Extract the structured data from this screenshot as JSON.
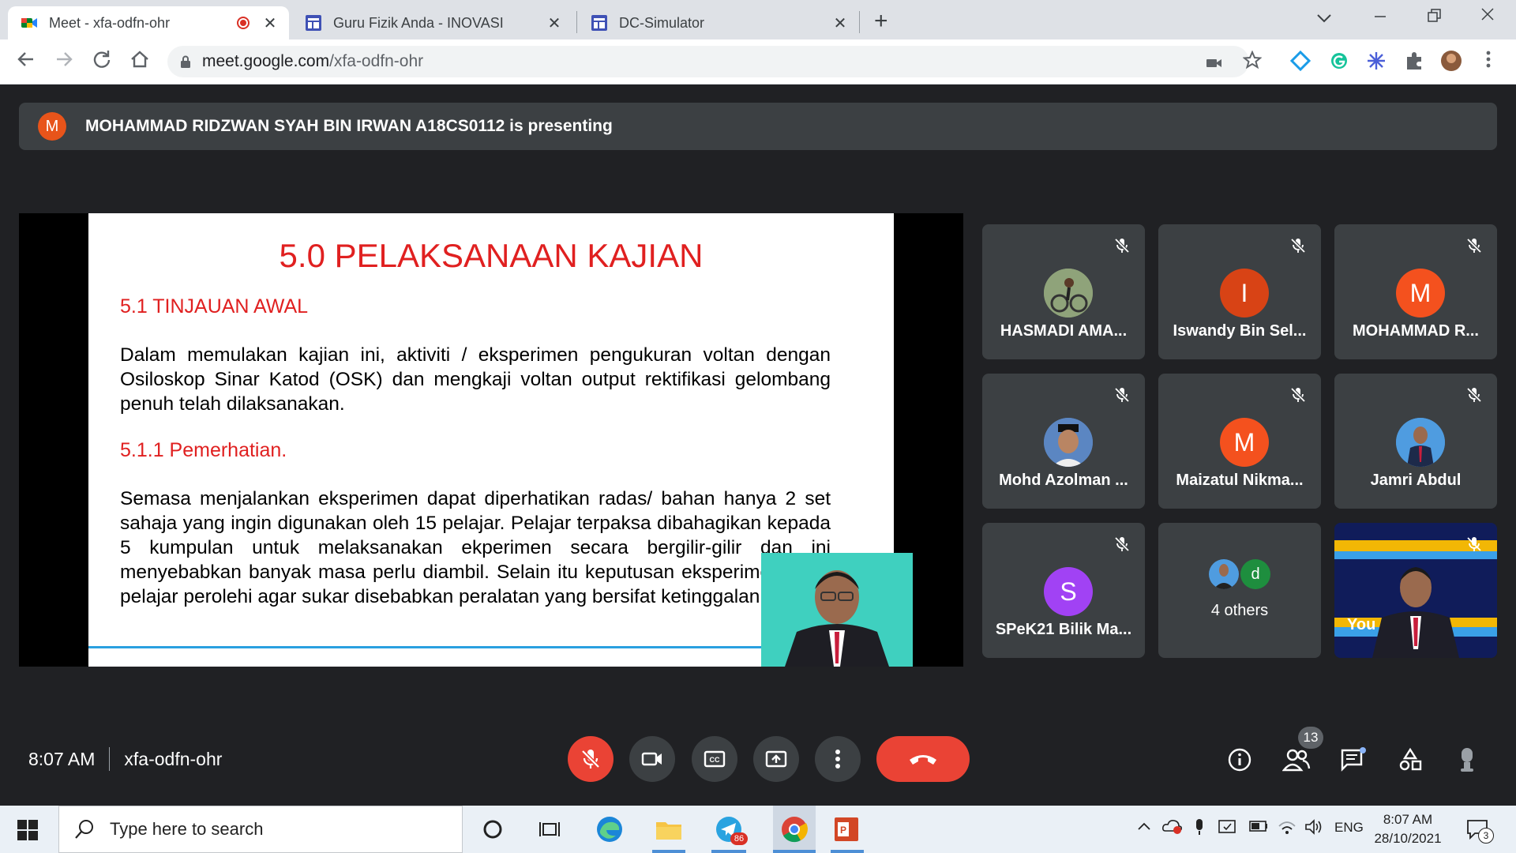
{
  "browser": {
    "tabs": [
      {
        "title": "Meet - xfa-odfn-ohr",
        "icon": "google-meet-icon",
        "recording": true
      },
      {
        "title": "Guru Fizik Anda - INOVASI",
        "icon": "google-sites-icon"
      },
      {
        "title": "DC-Simulator",
        "icon": "google-sites-icon"
      }
    ],
    "url_domain": "meet.google.com",
    "url_path": "/xfa-odfn-ohr"
  },
  "meet": {
    "presenter_initial": "M",
    "presenter_text": "MOHAMMAD RIDZWAN SYAH BIN IRWAN A18CS0112 is presenting",
    "slide": {
      "title": "5.0 PELAKSANAAN KAJIAN",
      "section1": "5.1 TINJAUAN AWAL",
      "para1": "Dalam memulakan kajian ini, aktiviti / eksperimen pengukuran voltan dengan Osiloskop Sinar Katod (OSK) dan mengkaji voltan output rektifikasi gelombang penuh telah dilaksanakan.",
      "section2": "5.1.1 Pemerhatian.",
      "para2": "Semasa menjalankan eksperimen dapat diperhatikan radas/ bahan hanya 2 set sahaja yang ingin digunakan oleh 15 pelajar. Pelajar terpaksa dibahagikan kepada 5 kumpulan untuk melaksanakan ekperimen secara bergilir-gilir dan ini menyebabkan banyak masa perlu diambil. Selain itu keputusan eksperimen yang pelajar perolehi agar sukar disebabkan peralatan yang bersifat ketinggalan zaman."
    },
    "participants": [
      {
        "name": "HASMADI AMA...",
        "initial": "",
        "color": "#7d8a6a",
        "muted": true
      },
      {
        "name": "Iswandy Bin Sel...",
        "initial": "I",
        "color": "#d84315",
        "muted": true
      },
      {
        "name": "MOHAMMAD R...",
        "initial": "M",
        "color": "#f4511e",
        "muted": true
      },
      {
        "name": "Mohd Azolman ...",
        "initial": "",
        "color": "#4a6fa5",
        "muted": true
      },
      {
        "name": "Maizatul Nikma...",
        "initial": "M",
        "color": "#f4511e",
        "muted": true
      },
      {
        "name": "Jamri Abdul",
        "initial": "",
        "color": "#3b7dc4",
        "muted": true
      },
      {
        "name": "SPeK21 Bilik Ma...",
        "initial": "S",
        "color": "#a142f4",
        "muted": true
      }
    ],
    "others": {
      "label": "4 others",
      "initial": "d"
    },
    "self_label": "You",
    "time": "8:07 AM",
    "meeting_code": "xfa-odfn-ohr",
    "people_count": "13",
    "colors": {
      "red": "#ea4335",
      "surface": "#3c4043",
      "bg": "#202124"
    }
  },
  "taskbar": {
    "search_placeholder": "Type here to search",
    "language": "ENG",
    "clock_time": "8:07 AM",
    "clock_date": "28/10/2021",
    "telegram_badge": "86",
    "notif_count": "3"
  }
}
